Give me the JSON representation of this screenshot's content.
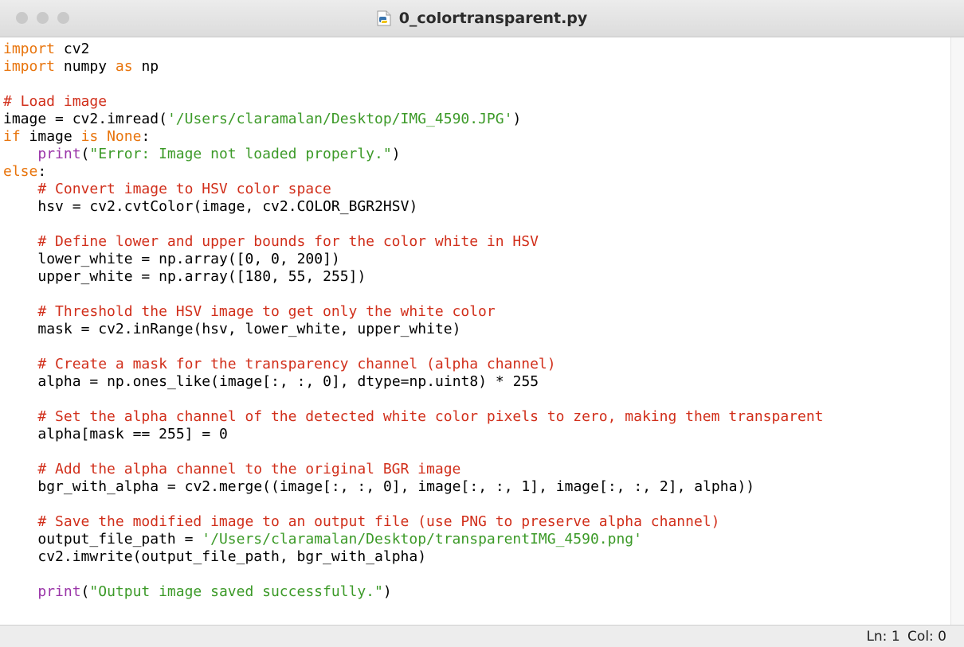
{
  "window": {
    "title": "0_colortransparent.py",
    "file_icon": "python-file-icon"
  },
  "code_lines": [
    "import cv2",
    "import numpy as np",
    "",
    "# Load image",
    "image = cv2.imread('/Users/claramalan/Desktop/IMG_4590.JPG')",
    "if image is None:",
    "    print(\"Error: Image not loaded properly.\")",
    "else:",
    "    # Convert image to HSV color space",
    "    hsv = cv2.cvtColor(image, cv2.COLOR_BGR2HSV)",
    "",
    "    # Define lower and upper bounds for the color white in HSV",
    "    lower_white = np.array([0, 0, 200])",
    "    upper_white = np.array([180, 55, 255])",
    "",
    "    # Threshold the HSV image to get only the white color",
    "    mask = cv2.inRange(hsv, lower_white, upper_white)",
    "",
    "    # Create a mask for the transparency channel (alpha channel)",
    "    alpha = np.ones_like(image[:, :, 0], dtype=np.uint8) * 255",
    "",
    "    # Set the alpha channel of the detected white color pixels to zero, making them transparent",
    "    alpha[mask == 255] = 0",
    "",
    "    # Add the alpha channel to the original BGR image",
    "    bgr_with_alpha = cv2.merge((image[:, :, 0], image[:, :, 1], image[:, :, 2], alpha))",
    "",
    "    # Save the modified image to an output file (use PNG to preserve alpha channel)",
    "    output_file_path = '/Users/claramalan/Desktop/transparentIMG_4590.png'",
    "    cv2.imwrite(output_file_path, bgr_with_alpha)",
    "",
    "    print(\"Output image saved successfully.\")"
  ],
  "syntax_colors": {
    "keyword": "#e8740c",
    "comment": "#d12f1b",
    "string": "#3c9a28",
    "builtin": "#9a34a8",
    "default": "#000000"
  },
  "status": {
    "line_label": "Ln: 1",
    "col_label": "Col: 0"
  }
}
